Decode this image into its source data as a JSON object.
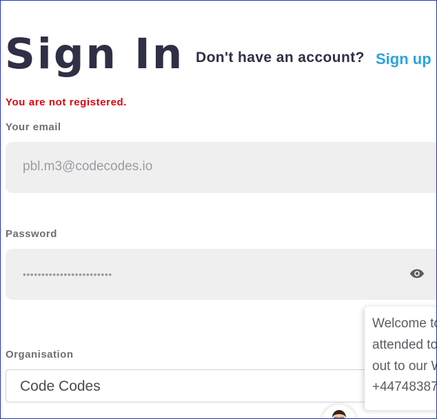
{
  "header": {
    "title": "Sign In",
    "prompt": "Don't have an account?",
    "signup_link": "Sign up"
  },
  "form": {
    "error_message": "You are not registered.",
    "email": {
      "label": "Your email",
      "value": "pbl.m3@codecodes.io"
    },
    "password": {
      "label": "Password",
      "masked_value": "••••••••••••••••••••••••",
      "toggle_icon": "eye-icon"
    },
    "organisation": {
      "label": "Organisation",
      "value": "Code Codes"
    }
  },
  "chat": {
    "lines": [
      "Welcome to",
      "attended to",
      "out to our W",
      "+44748387"
    ],
    "avatar_icon": "agent-avatar"
  },
  "colors": {
    "title": "#2f2f45",
    "link": "#2aa3e0",
    "error": "#e3000f",
    "field_bg": "#efefef"
  }
}
